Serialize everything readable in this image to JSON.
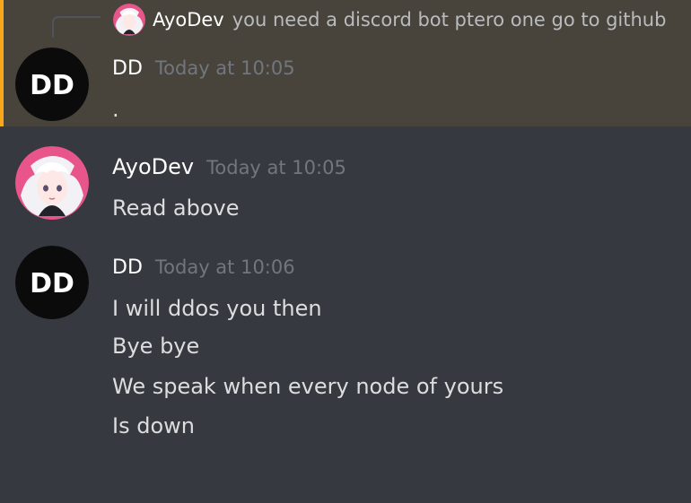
{
  "reply_preview": {
    "author": "AyoDev",
    "text": "you need a discord bot ptero one go to github"
  },
  "messages": [
    {
      "author": "DD",
      "timestamp": "Today at 10:05",
      "lines": [
        "."
      ],
      "highlighted": true,
      "avatar_initials": "DD"
    },
    {
      "author": "AyoDev",
      "timestamp": "Today at 10:05",
      "lines": [
        "Read above"
      ]
    },
    {
      "author": "DD",
      "timestamp": "Today at 10:06",
      "lines": [
        "I will ddos you then",
        "Bye bye",
        "We speak when every node of yours",
        "Is down"
      ],
      "avatar_initials": "DD"
    }
  ],
  "colors": {
    "background": "#36393f",
    "highlight_background": "#48443c",
    "highlight_bar": "#faa61a",
    "username": "#ffffff",
    "timestamp": "#72767d",
    "message_text": "#dcddde",
    "reply_text": "#b9bbbe"
  }
}
